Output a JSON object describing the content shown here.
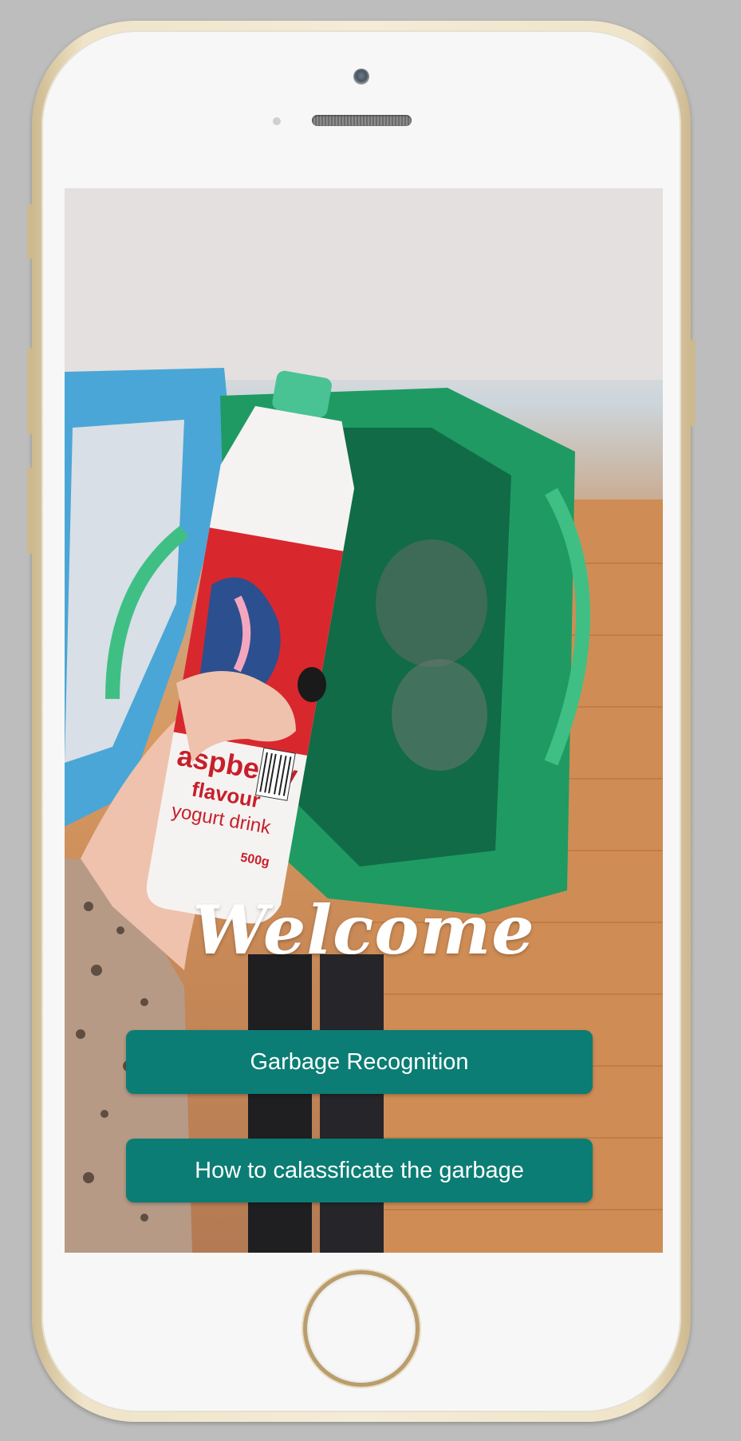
{
  "screen": {
    "welcome_title": "Welcome",
    "buttons": [
      {
        "label": "Garbage Recognition"
      },
      {
        "label": "How to calassficate the garbage"
      }
    ],
    "photo": {
      "bottle_brand_lines": [
        "aspberry",
        "flavour",
        "yogurt drink",
        "500g"
      ]
    }
  },
  "colors": {
    "button_background": "#0b7d74",
    "button_text": "#ffffff",
    "phone_frame": "#efe4c9",
    "background": "#bdbdbd"
  }
}
